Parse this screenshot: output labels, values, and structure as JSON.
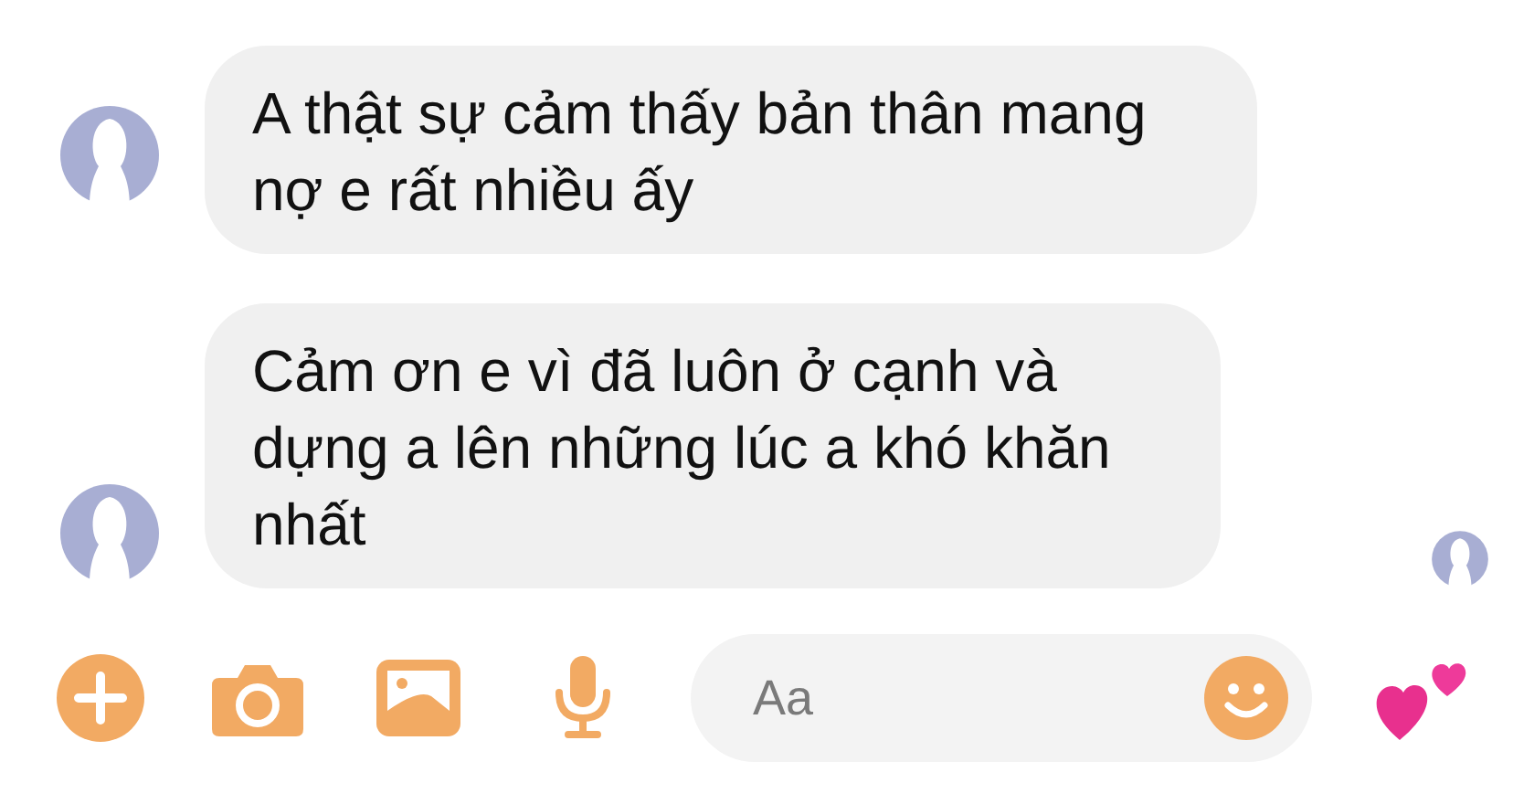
{
  "messages": [
    {
      "text": "A thật sự cảm thấy bản thân mang nợ e rất nhiều ấy",
      "seen": false
    },
    {
      "text": "Cảm ơn e vì đã luôn ở cạnh và dựng a lên những lúc a khó khăn nhất",
      "seen": true
    }
  ],
  "composer": {
    "placeholder": "Aa"
  }
}
